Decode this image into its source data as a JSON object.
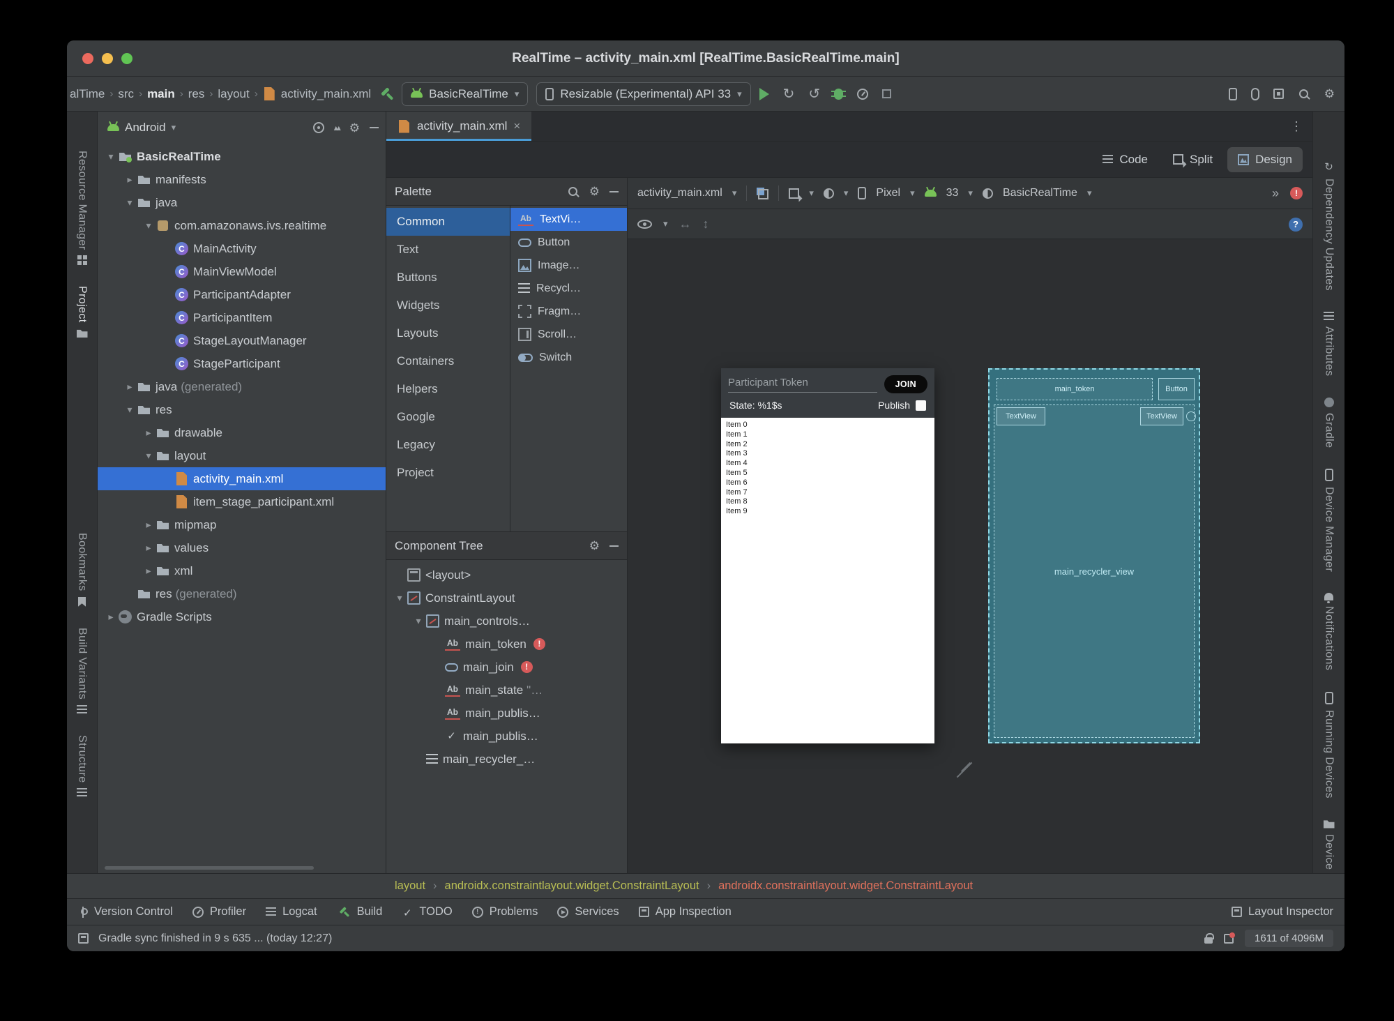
{
  "icons": {
    "chevron-expanded": "▾",
    "chevron-collapsed": "▸",
    "dropdown-caret": "▾",
    "close": "×",
    "overflow-vertical": "⋮",
    "chevrons-more": "»",
    "breadcrumb-separator": "›",
    "settings-gear": "⚙",
    "error-badge": "!",
    "check": "✓",
    "arrow-horizontal": "↔",
    "arrow-vertical": "↕",
    "rerun": "↻",
    "apply-changes": "↺",
    "help": "?"
  },
  "colors": {
    "accent_blue": "#3570D4",
    "error_red": "#D75A5A",
    "run_green": "#5FAD65",
    "xml_orange": "#D08A45",
    "blueprint_cyan": "#8FD8E5"
  },
  "window": {
    "title": "RealTime – activity_main.xml [RealTime.BasicRealTime.main]"
  },
  "toolbar": {
    "breadcrumbs": [
      "alTime",
      "src",
      "main",
      "res",
      "layout",
      "activity_main.xml"
    ],
    "run_config": "BasicRealTime",
    "device_selector": "Resizable (Experimental) API 33"
  },
  "left_strip": {
    "items": [
      "Resource Manager",
      "Project",
      "Bookmarks",
      "Build Variants",
      "Structure"
    ],
    "active": "Project"
  },
  "right_strip": {
    "items": [
      "Dependency Updates",
      "Attributes",
      "Gradle",
      "Device Manager",
      "Notifications",
      "Running Devices",
      "Device File Explorer"
    ]
  },
  "project_panel": {
    "view": "Android",
    "tree": [
      {
        "label": "BasicRealTime",
        "depth": 0,
        "chevron": "open",
        "icon": "android-module"
      },
      {
        "label": "manifests",
        "depth": 1,
        "chevron": "closed",
        "icon": "folder"
      },
      {
        "label": "java",
        "depth": 1,
        "chevron": "open",
        "icon": "folder"
      },
      {
        "label": "com.amazonaws.ivs.realtime",
        "depth": 2,
        "chevron": "open",
        "icon": "package"
      },
      {
        "label": "MainActivity",
        "depth": 3,
        "chevron": "none",
        "icon": "class"
      },
      {
        "label": "MainViewModel",
        "depth": 3,
        "chevron": "none",
        "icon": "class"
      },
      {
        "label": "ParticipantAdapter",
        "depth": 3,
        "chevron": "none",
        "icon": "class"
      },
      {
        "label": "ParticipantItem",
        "depth": 3,
        "chevron": "none",
        "icon": "class"
      },
      {
        "label": "StageLayoutManager",
        "depth": 3,
        "chevron": "none",
        "icon": "class"
      },
      {
        "label": "StageParticipant",
        "depth": 3,
        "chevron": "none",
        "icon": "class"
      },
      {
        "label": "java",
        "suffix": " (generated)",
        "depth": 1,
        "chevron": "closed",
        "icon": "folder"
      },
      {
        "label": "res",
        "depth": 1,
        "chevron": "open",
        "icon": "folder"
      },
      {
        "label": "drawable",
        "depth": 2,
        "chevron": "closed",
        "icon": "folder"
      },
      {
        "label": "layout",
        "depth": 2,
        "chevron": "open",
        "icon": "folder"
      },
      {
        "label": "activity_main.xml",
        "depth": 3,
        "chevron": "none",
        "icon": "xml-file",
        "selected": true
      },
      {
        "label": "item_stage_participant.xml",
        "depth": 3,
        "chevron": "none",
        "icon": "xml-file"
      },
      {
        "label": "mipmap",
        "depth": 2,
        "chevron": "closed",
        "icon": "folder"
      },
      {
        "label": "values",
        "depth": 2,
        "chevron": "closed",
        "icon": "folder"
      },
      {
        "label": "xml",
        "depth": 2,
        "chevron": "closed",
        "icon": "folder"
      },
      {
        "label": "res",
        "suffix": " (generated)",
        "depth": 1,
        "chevron": "none",
        "icon": "folder"
      },
      {
        "label": "Gradle Scripts",
        "depth": 0,
        "chevron": "closed",
        "icon": "gradle"
      }
    ]
  },
  "editor": {
    "tab": "activity_main.xml",
    "modes": [
      "Code",
      "Split",
      "Design"
    ],
    "active_mode": "Design"
  },
  "palette": {
    "title": "Palette",
    "categories": [
      "Common",
      "Text",
      "Buttons",
      "Widgets",
      "Layouts",
      "Containers",
      "Helpers",
      "Google",
      "Legacy",
      "Project"
    ],
    "selected_category": "Common",
    "components": [
      {
        "label": "TextVi…",
        "icon": "textview",
        "selected": true
      },
      {
        "label": "Button",
        "icon": "button"
      },
      {
        "label": "Image…",
        "icon": "imageview"
      },
      {
        "label": "Recycl…",
        "icon": "recyclerview"
      },
      {
        "label": "Fragm…",
        "icon": "fragment"
      },
      {
        "label": "Scroll…",
        "icon": "scrollview"
      },
      {
        "label": "Switch",
        "icon": "switch"
      }
    ]
  },
  "component_tree": {
    "title": "Component Tree",
    "items": [
      {
        "label": "<layout>",
        "depth": 0,
        "chevron": "none",
        "icon": "layout"
      },
      {
        "label": "ConstraintLayout",
        "depth": 0,
        "chevron": "open",
        "icon": "constraint-layout"
      },
      {
        "label": "main_controls…",
        "depth": 1,
        "chevron": "open",
        "icon": "constraint-layout"
      },
      {
        "label": "main_token",
        "depth": 2,
        "chevron": "none",
        "icon": "textview",
        "badge": "error"
      },
      {
        "label": "main_join",
        "depth": 2,
        "chevron": "none",
        "icon": "button",
        "badge": "error"
      },
      {
        "label": "main_state",
        "suffix": "\"…",
        "depth": 2,
        "chevron": "none",
        "icon": "textview"
      },
      {
        "label": "main_publis…",
        "depth": 2,
        "chevron": "none",
        "icon": "textview"
      },
      {
        "label": "main_publis…",
        "depth": 2,
        "chevron": "none",
        "icon": "checkbox"
      },
      {
        "label": "main_recycler_…",
        "depth": 1,
        "chevron": "none",
        "icon": "recyclerview"
      }
    ]
  },
  "design_toolbar": {
    "file": "activity_main.xml",
    "device": "Pixel",
    "api": "33",
    "theme": "BasicRealTime",
    "overflow": "»"
  },
  "canvas": {
    "design_preview": {
      "token_hint": "Participant Token",
      "join_button": "JOIN",
      "state_label": "State: %1$s",
      "publish_label": "Publish",
      "list_items": [
        "Item 0",
        "Item 1",
        "Item 2",
        "Item 3",
        "Item 4",
        "Item 5",
        "Item 6",
        "Item 7",
        "Item 8",
        "Item 9"
      ]
    },
    "blueprint": {
      "token": "main_token",
      "button": "Button",
      "textview_left": "TextView",
      "textview_right": "TextView",
      "recycler": "main_recycler_view"
    }
  },
  "breadcrumb_bar": [
    "layout",
    "androidx.constraintlayout.widget.ConstraintLayout",
    "androidx.constraintlayout.widget.ConstraintLayout"
  ],
  "tool_window_bar": {
    "left": [
      "Version Control",
      "Profiler",
      "Logcat",
      "Build",
      "TODO",
      "Problems",
      "Services",
      "App Inspection"
    ],
    "right": [
      "Layout Inspector"
    ]
  },
  "status_bar": {
    "message": "Gradle sync finished in 9 s 635 ... (today 12:27)",
    "memory": "1611 of 4096M"
  }
}
